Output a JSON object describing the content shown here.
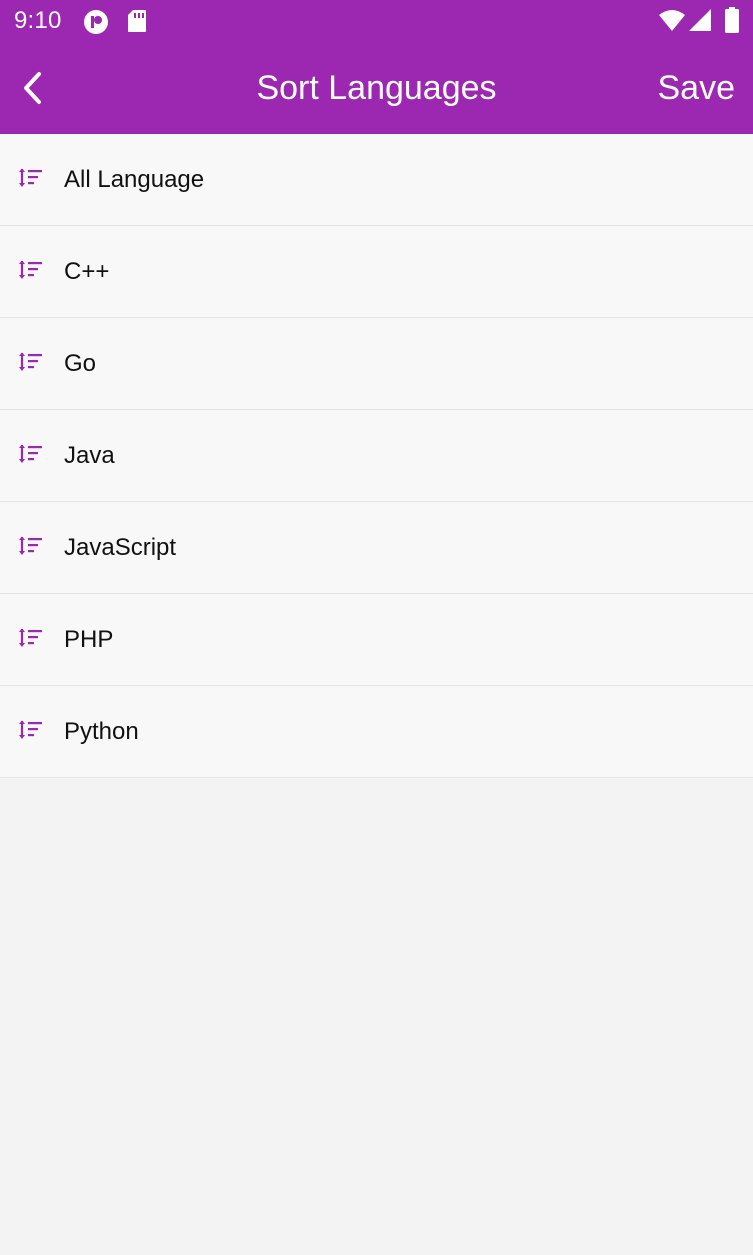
{
  "status_bar": {
    "time": "9:10",
    "icons": [
      "notification-app-icon",
      "sd-card-icon",
      "wifi-icon",
      "signal-icon",
      "battery-icon"
    ]
  },
  "toolbar": {
    "back_icon": "chevron-left-icon",
    "title": "Sort Languages",
    "save_label": "Save"
  },
  "languages": {
    "items": [
      {
        "label": "All Language",
        "icon": "sort-icon"
      },
      {
        "label": "C++",
        "icon": "sort-icon"
      },
      {
        "label": "Go",
        "icon": "sort-icon"
      },
      {
        "label": "Java",
        "icon": "sort-icon"
      },
      {
        "label": "JavaScript",
        "icon": "sort-icon"
      },
      {
        "label": "PHP",
        "icon": "sort-icon"
      },
      {
        "label": "Python",
        "icon": "sort-icon"
      }
    ]
  },
  "colors": {
    "primary": "#9c27b0",
    "background": "#f3f3f3",
    "list_item_bg": "#f8f8f8",
    "divider": "#e6e6e6",
    "text": "#111111"
  }
}
